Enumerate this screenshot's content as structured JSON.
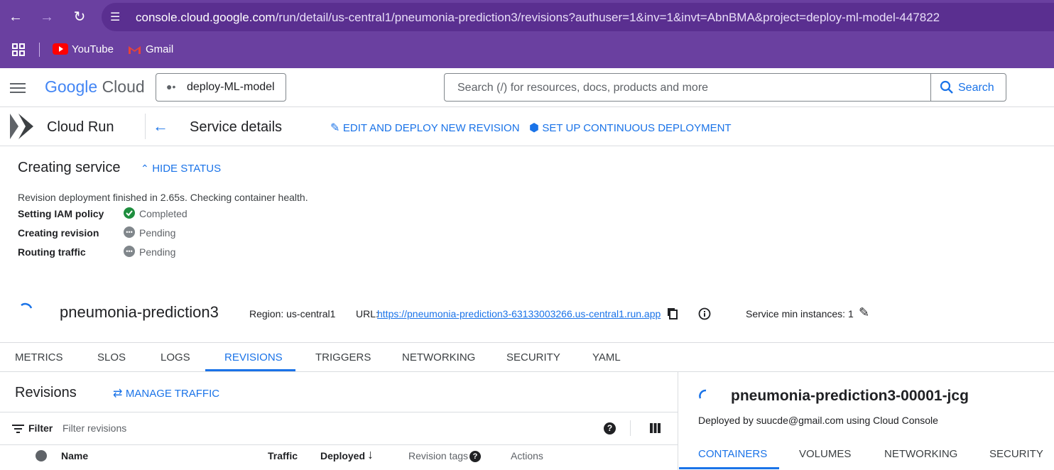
{
  "browser": {
    "url_host": "console.cloud.google.com",
    "url_path": "/run/detail/us-central1/pneumonia-prediction3/revisions?authuser=1&inv=1&invt=AbnBMA&project=deploy-ml-model-447822",
    "bookmarks": [
      {
        "label": "YouTube",
        "icon": "youtube-icon"
      },
      {
        "label": "Gmail",
        "icon": "gmail-icon"
      }
    ]
  },
  "header": {
    "brand_google": "Google",
    "brand_cloud": "Cloud",
    "project": "deploy-ML-model",
    "search_placeholder": "Search (/) for resources, docs, products and more",
    "search_button": "Search"
  },
  "service_header": {
    "product": "Cloud Run",
    "title": "Service details",
    "edit_deploy": "EDIT AND DEPLOY NEW REVISION",
    "continuous": "SET UP CONTINUOUS DEPLOYMENT"
  },
  "status": {
    "title": "Creating service",
    "hide": "HIDE STATUS",
    "message": "Revision deployment finished in 2.65s. Checking container health.",
    "steps": [
      {
        "label": "Setting IAM policy",
        "state": "Completed"
      },
      {
        "label": "Creating revision",
        "state": "Pending"
      },
      {
        "label": "Routing traffic",
        "state": "Pending"
      }
    ]
  },
  "service": {
    "name": "pneumonia-prediction3",
    "region_label": "Region: us-central1",
    "url_label": "URL:",
    "url": "https://pneumonia-prediction3-63133003266.us-central1.run.app",
    "min_instances": "Service min instances: 1"
  },
  "tabs": [
    "METRICS",
    "SLOS",
    "LOGS",
    "REVISIONS",
    "TRIGGERS",
    "NETWORKING",
    "SECURITY",
    "YAML"
  ],
  "revisions": {
    "title": "Revisions",
    "manage": "MANAGE TRAFFIC",
    "filter_label": "Filter",
    "filter_placeholder": "Filter revisions",
    "columns": [
      "Name",
      "Traffic",
      "Deployed",
      "Revision tags",
      "Actions"
    ]
  },
  "detail": {
    "name": "pneumonia-prediction3-00001-jcg",
    "deployed_by": "Deployed by suucde@gmail.com using Cloud Console",
    "tabs": [
      "CONTAINERS",
      "VOLUMES",
      "NETWORKING",
      "SECURITY"
    ]
  },
  "colors": {
    "browser_bar": "#6a40a0",
    "accent": "#1a73e8",
    "success": "#1e8e3e",
    "pending": "#80868b"
  }
}
